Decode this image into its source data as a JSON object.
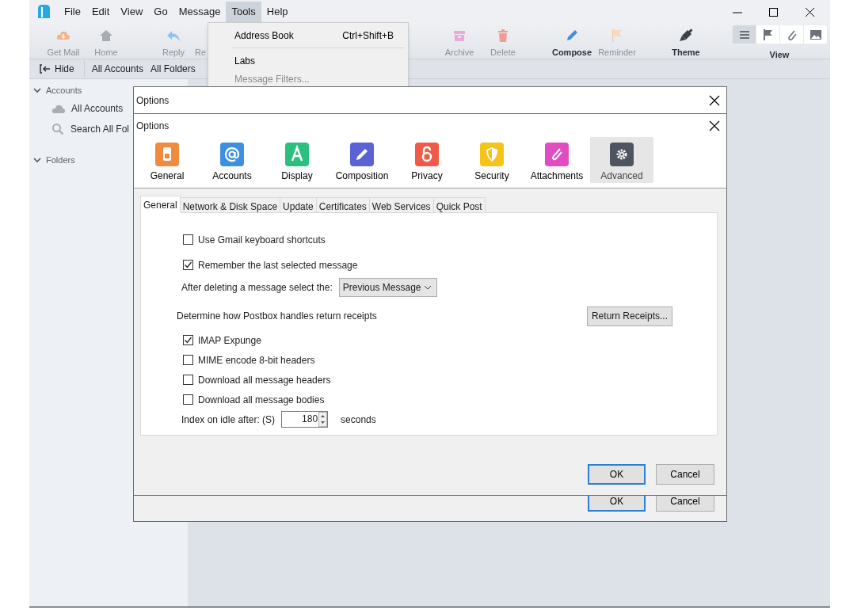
{
  "menu_bar": [
    {
      "label": "File",
      "selected": false
    },
    {
      "label": "Edit",
      "selected": false
    },
    {
      "label": "View",
      "selected": false
    },
    {
      "label": "Go",
      "selected": false
    },
    {
      "label": "Message",
      "selected": false
    },
    {
      "label": "Tools",
      "selected": true
    },
    {
      "label": "Help",
      "selected": false
    }
  ],
  "tools_menu": [
    {
      "kind": "item",
      "label": "Address Book",
      "shortcut": "Ctrl+Shift+B",
      "disabled": false
    },
    {
      "kind": "separator"
    },
    {
      "kind": "item",
      "label": "Labs",
      "disabled": false
    },
    {
      "kind": "item",
      "label": "Message Filters...",
      "disabled": true
    }
  ],
  "toolbar": [
    {
      "kind": "get-mail",
      "label": "Get Mail",
      "disabled": true
    },
    {
      "kind": "home",
      "label": "Home",
      "disabled": true
    },
    {
      "kind": "reply",
      "label": "Reply",
      "disabled": true
    },
    {
      "kind": "partial",
      "label": "Re",
      "disabled": true
    },
    {
      "kind": "archive",
      "label": "Archive",
      "disabled": true
    },
    {
      "kind": "delete",
      "label": "Delete",
      "disabled": true
    },
    {
      "kind": "compose",
      "label": "Compose",
      "disabled": false
    },
    {
      "kind": "reminder",
      "label": "Reminder",
      "disabled": true
    },
    {
      "kind": "theme",
      "label": "Theme",
      "disabled": false
    }
  ],
  "view_control": {
    "label": "View",
    "options": [
      {
        "kind": "list",
        "selected": true
      },
      {
        "kind": "flag",
        "selected": false
      },
      {
        "kind": "attachment",
        "selected": false
      },
      {
        "kind": "image",
        "selected": false
      }
    ]
  },
  "folder_bar": [
    {
      "kind": "hide",
      "label": "Hide"
    },
    {
      "kind": "plain",
      "label": "All Accounts"
    },
    {
      "kind": "plain",
      "label": "All Folders"
    }
  ],
  "sidebar": [
    {
      "label": "Accounts",
      "expanded": true,
      "items": [
        {
          "kind": "cloud",
          "label": "All Accounts"
        },
        {
          "kind": "search",
          "label": "Search All Fol"
        }
      ]
    },
    {
      "label": "Folders",
      "expanded": true
    }
  ],
  "back_dialog": {
    "title": "Options",
    "buttons": [
      "OK",
      "Cancel"
    ]
  },
  "dialog": {
    "title": "Options",
    "categories": [
      {
        "kind": "general",
        "label": "General",
        "selected": false
      },
      {
        "kind": "accounts",
        "label": "Accounts",
        "selected": false
      },
      {
        "kind": "display",
        "label": "Display",
        "selected": false
      },
      {
        "kind": "composition",
        "label": "Composition",
        "selected": false
      },
      {
        "kind": "privacy",
        "label": "Privacy",
        "selected": false
      },
      {
        "kind": "security",
        "label": "Security",
        "selected": false
      },
      {
        "kind": "attachments",
        "label": "Attachments",
        "selected": false
      },
      {
        "kind": "advanced",
        "label": "Advanced",
        "selected": true
      }
    ],
    "tabs": [
      {
        "label": "General",
        "selected": true
      },
      {
        "label": "Network & Disk Space",
        "selected": false
      },
      {
        "label": "Update",
        "selected": false
      },
      {
        "label": "Certificates",
        "selected": false
      },
      {
        "label": "Web Services",
        "selected": false
      },
      {
        "label": "Quick Post",
        "selected": false
      }
    ],
    "settings": [
      {
        "kind": "checkbox",
        "label": "Use Gmail keyboard shortcuts",
        "checked": false
      },
      {
        "kind": "checkbox",
        "label": "Remember the last selected message",
        "checked": true
      },
      {
        "kind": "dropdown",
        "label": "After deleting a message select the:",
        "value": "Previous Message"
      },
      {
        "kind": "button",
        "label": "Determine how Postbox handles return receipts",
        "button": "Return Receipts..."
      },
      {
        "kind": "checkbox",
        "label": "IMAP Expunge",
        "checked": true
      },
      {
        "kind": "checkbox",
        "label": "MIME encode 8-bit headers",
        "checked": false
      },
      {
        "kind": "checkbox",
        "label": "Download all message headers",
        "checked": false
      },
      {
        "kind": "checkbox",
        "label": "Download all message bodies",
        "checked": false
      },
      {
        "kind": "spin",
        "label": "Index on idle after: (S)",
        "value": "180",
        "unit": "seconds"
      }
    ],
    "buttons": [
      "OK",
      "Cancel"
    ]
  }
}
